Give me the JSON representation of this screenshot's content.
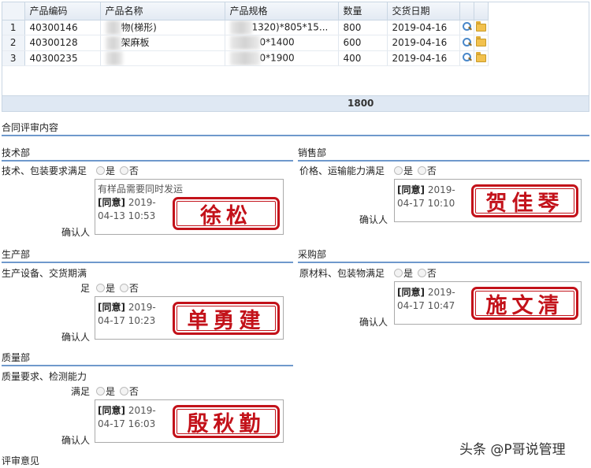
{
  "grid": {
    "headers": [
      "产品编码",
      "产品名称",
      "产品规格",
      "数量",
      "交货日期"
    ],
    "rows": [
      {
        "no": "1",
        "code": "40300146",
        "name": "物(梯形)",
        "spec": "1320)*805*15...",
        "qty": "800",
        "date": "2019-04-16"
      },
      {
        "no": "2",
        "code": "40300128",
        "name": "架麻板",
        "spec": "0*1400",
        "qty": "600",
        "date": "2019-04-16"
      },
      {
        "no": "3",
        "code": "40300235",
        "name": "",
        "spec": "0*1900",
        "qty": "400",
        "date": "2019-04-16"
      }
    ],
    "total": "1800"
  },
  "contract_review": {
    "title": "合同评审内容"
  },
  "options": {
    "yes": "是",
    "no": "否"
  },
  "confirm_label": "确认人",
  "departments": {
    "tech": {
      "title": "技术部",
      "question": "技术、包装要求满足",
      "note": "有样品需要同时发运",
      "agree": "[同意]",
      "date": "2019-",
      "time": "04-13 10:53",
      "signer": "徐松"
    },
    "sales": {
      "title": "销售部",
      "question": "价格、运输能力满足",
      "agree": "[同意]",
      "date": "2019-",
      "time": "04-17 10:10",
      "signer": "贺佳琴"
    },
    "production": {
      "title": "生产部",
      "question_line1": "生产设备、交货期满",
      "question_line2": "足",
      "agree": "[同意]",
      "date": "2019-",
      "time": "04-17 10:23",
      "signer": "单勇建"
    },
    "purchase": {
      "title": "采购部",
      "question": "原材料、包装物满足",
      "agree": "[同意]",
      "date": "2019-",
      "time": "04-17 10:47",
      "signer": "施文清"
    },
    "quality": {
      "title": "质量部",
      "question_line1": "质量要求、检测能力",
      "question_line2": "满足",
      "agree": "[同意]",
      "date": "2019-",
      "time": "04-17 16:03",
      "signer": "殷秋勤"
    }
  },
  "review_opinion": {
    "title": "评审意见"
  },
  "watermark": "头条 @P哥说管理",
  "colors": {
    "stamp_red": "#c3121a",
    "section_line": "#6f99cc",
    "grid_header": "#e3eaf3"
  }
}
